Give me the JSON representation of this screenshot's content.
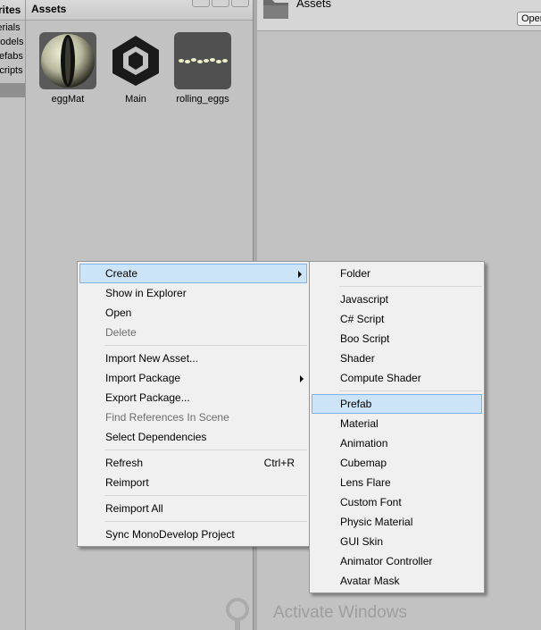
{
  "tree": {
    "header": "Favorites",
    "items": [
      "Materials",
      "Models",
      "Prefabs",
      "Scripts"
    ]
  },
  "assets_panel": {
    "title": "Assets",
    "items": [
      {
        "label": "eggMat",
        "icon": "material-sphere-icon"
      },
      {
        "label": "Main",
        "icon": "unity-scene-icon"
      },
      {
        "label": "rolling_eggs",
        "icon": "model-preview-icon"
      }
    ]
  },
  "inspector": {
    "title": "Assets",
    "open_button": "Open"
  },
  "context_menu": {
    "items": [
      {
        "label": "Create",
        "submenu": true,
        "highlight": true
      },
      {
        "label": "Show in Explorer"
      },
      {
        "label": "Open"
      },
      {
        "label": "Delete",
        "disabled": true
      },
      {
        "separator": true
      },
      {
        "label": "Import New Asset..."
      },
      {
        "label": "Import Package",
        "submenu": true
      },
      {
        "label": "Export Package..."
      },
      {
        "label": "Find References In Scene",
        "disabled": true
      },
      {
        "label": "Select Dependencies"
      },
      {
        "separator": true
      },
      {
        "label": "Refresh",
        "shortcut": "Ctrl+R"
      },
      {
        "label": "Reimport"
      },
      {
        "separator": true
      },
      {
        "label": "Reimport All"
      },
      {
        "separator": true
      },
      {
        "label": "Sync MonoDevelop Project"
      }
    ]
  },
  "create_submenu": {
    "items": [
      {
        "label": "Folder"
      },
      {
        "separator": true
      },
      {
        "label": "Javascript"
      },
      {
        "label": "C# Script"
      },
      {
        "label": "Boo Script"
      },
      {
        "label": "Shader"
      },
      {
        "label": "Compute Shader"
      },
      {
        "separator": true
      },
      {
        "label": "Prefab",
        "highlight": true
      },
      {
        "label": "Material"
      },
      {
        "label": "Animation"
      },
      {
        "label": "Cubemap"
      },
      {
        "label": "Lens Flare"
      },
      {
        "label": "Custom Font"
      },
      {
        "label": "Physic Material"
      },
      {
        "label": "GUI Skin"
      },
      {
        "label": "Animator Controller"
      },
      {
        "label": "Avatar Mask"
      }
    ]
  },
  "watermark": "Activate Windows",
  "colors": {
    "menu_bg": "#f0f0f0",
    "highlight_bg": "#cce4f7",
    "highlight_border": "#7eb4ea",
    "panel_bg": "#c2c2c2",
    "disabled_text": "#6d6d6d"
  }
}
